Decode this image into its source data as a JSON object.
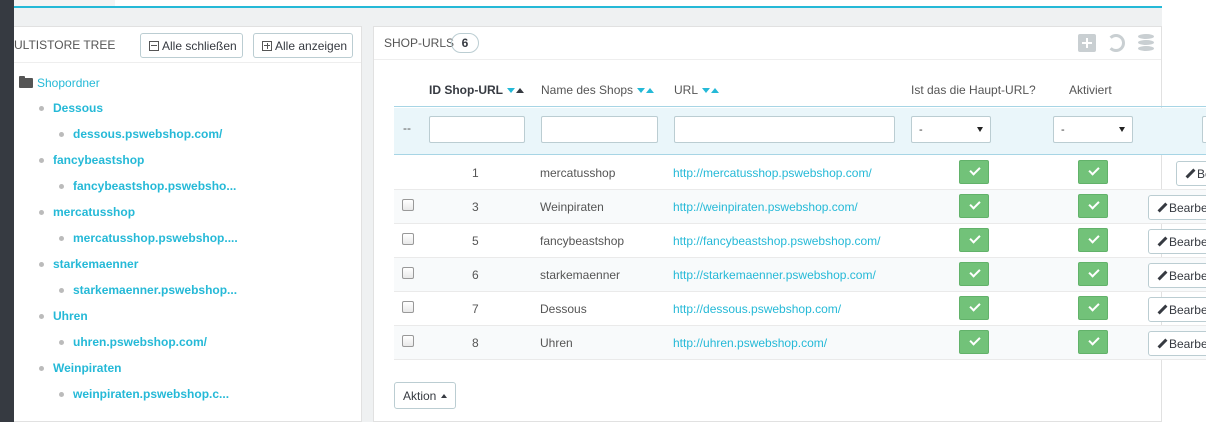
{
  "tree_panel": {
    "title": "ULTISTORE TREE",
    "collapse_label": "Alle schließen",
    "expand_label": "Alle anzeigen",
    "root": "Shopordner",
    "nodes": [
      {
        "shop": "Dessous",
        "url": "dessous.pswebshop.com/"
      },
      {
        "shop": "fancybeastshop",
        "url": "fancybeastshop.pswebsho..."
      },
      {
        "shop": "mercatusshop",
        "url": "mercatusshop.pswebshop...."
      },
      {
        "shop": "starkemaenner",
        "url": "starkemaenner.pswebshop..."
      },
      {
        "shop": "Uhren",
        "url": "uhren.pswebshop.com/"
      },
      {
        "shop": "Weinpiraten",
        "url": "weinpiraten.pswebshop.c..."
      }
    ]
  },
  "url_panel": {
    "title": "SHOP-URLS",
    "count": "6",
    "header_icons": [
      "add-icon",
      "refresh-icon",
      "database-icon"
    ],
    "columns": [
      "ID Shop-URL",
      "Name des Shops",
      "URL",
      "Ist das die Haupt-URL?",
      "Aktiviert"
    ],
    "filter_dashes": "--",
    "filter_select_main": "-",
    "filter_select_active": "-",
    "edit_label": "Bearbeiten",
    "rows": [
      {
        "id": "1",
        "name": "mercatusshop",
        "url": "http://mercatusshop.pswebshop.com/"
      },
      {
        "id": "3",
        "name": "Weinpiraten",
        "url": "http://weinpiraten.pswebshop.com/"
      },
      {
        "id": "5",
        "name": "fancybeastshop",
        "url": "http://fancybeastshop.pswebshop.com/"
      },
      {
        "id": "6",
        "name": "starkemaenner",
        "url": "http://starkemaenner.pswebshop.com/"
      },
      {
        "id": "7",
        "name": "Dessous",
        "url": "http://dessous.pswebshop.com/"
      },
      {
        "id": "8",
        "name": "Uhren",
        "url": "http://uhren.pswebshop.com/"
      }
    ],
    "bulk_action_label": "Aktion"
  }
}
